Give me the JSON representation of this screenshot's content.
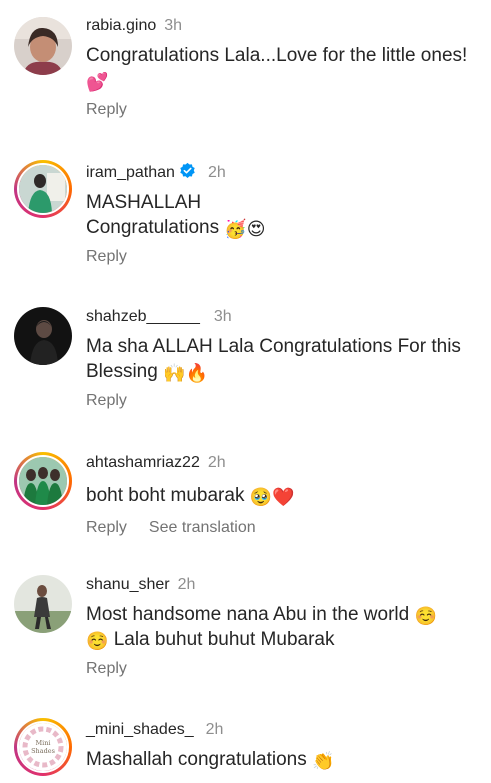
{
  "comments": [
    {
      "username": "rabia.gino",
      "time": "3h",
      "text": "Congratulations Lala...Love for the little ones!",
      "emojis": "💕",
      "reply": "Reply"
    },
    {
      "username": "iram_pathan",
      "time": "2h",
      "line1": "MASHALLAH",
      "line2": "Congratulations",
      "emojis": "🥳😍",
      "reply": "Reply"
    },
    {
      "username": "shahzeb______",
      "time": "3h",
      "text": "Ma sha ALLAH Lala Congratulations For this Blessing",
      "emojis": "🙌🔥",
      "reply": "Reply"
    },
    {
      "username": "ahtashamriaz22",
      "time": "2h",
      "text": "boht boht mubarak",
      "emojis": "🥹❤️",
      "reply": "Reply",
      "see_translation": "See translation"
    },
    {
      "username": "shanu_sher",
      "time": "2h",
      "text_before": "Most handsome nana Abu in the world",
      "emoji_mid": "☺️",
      "emoji_start2": "☺️",
      "text_after": "Lala buhut buhut Mubarak",
      "reply": "Reply"
    },
    {
      "username": "_mini_shades_",
      "time": "2h",
      "text": "Mashallah congratulations",
      "emojis": "👏",
      "avatar_text": "Mini Shades"
    }
  ],
  "colors": {
    "username": "#262626",
    "meta": "#8e8e8e",
    "action": "#737373",
    "verified": "#0095f6"
  },
  "icons": {
    "verified": "verified-badge-icon"
  }
}
